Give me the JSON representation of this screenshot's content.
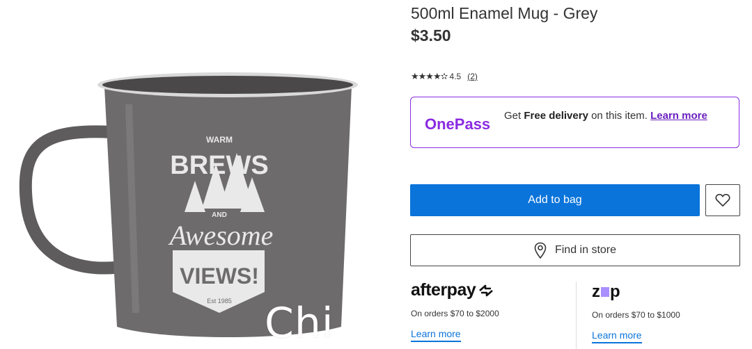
{
  "product": {
    "title": "500ml Enamel Mug - Grey",
    "price": "$3.50",
    "image_alt_texts": {
      "warm": "WARM",
      "brews": "BREWS",
      "and": "AND",
      "awesome": "Awesome",
      "views": "VIEWS!",
      "est": "Est 1985"
    },
    "overlay_text": "Chi"
  },
  "rating": {
    "stars": "★★★★✫",
    "score": "4.5",
    "count": "(2)"
  },
  "onepass": {
    "logo": "OnePass",
    "text_prefix": "Get ",
    "text_bold": "Free delivery",
    "text_suffix": " on this item. ",
    "link": "Learn more"
  },
  "actions": {
    "add_to_bag": "Add to bag",
    "find_in_store": "Find in store"
  },
  "afterpay": {
    "logo": "afterpay",
    "sub": "On orders $70 to $2000",
    "link": "Learn more"
  },
  "zip": {
    "logo_left": "z",
    "logo_right": "p",
    "sub": "On orders $70 to $1000",
    "link": "Learn more"
  },
  "colors": {
    "accent_blue": "#0a74da",
    "onepass_purple": "#8a2be2",
    "mug_grey": "#6d6b6b"
  }
}
